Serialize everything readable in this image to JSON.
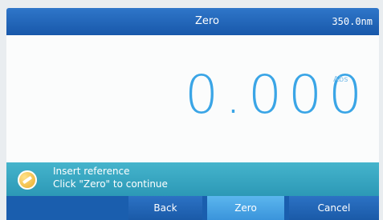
{
  "header": {
    "title": "Zero",
    "wavelength": "350.0nm"
  },
  "reading": {
    "value": "0.000",
    "unit": "Abs"
  },
  "message": {
    "icon": "reference-cuvette-icon",
    "line1": "Insert reference",
    "line2": "Click \"Zero\" to continue"
  },
  "buttons": {
    "back": "Back",
    "zero": "Zero",
    "cancel": "Cancel"
  },
  "colors": {
    "header": "#1f63b6",
    "reading": "#3aa5e6",
    "message_bar": "#2f9db8",
    "zero_button": "#4aa7e6"
  }
}
